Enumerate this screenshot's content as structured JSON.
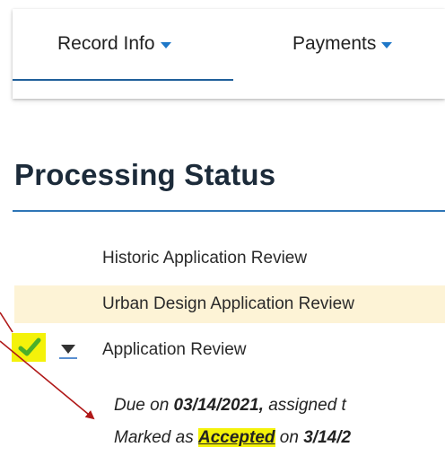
{
  "nav": {
    "tabs": [
      {
        "label": "Record Info",
        "active": true,
        "has_dropdown": true
      },
      {
        "label": "Payments",
        "active": false,
        "has_dropdown": true
      }
    ],
    "accent_color": "#1f78c8"
  },
  "section": {
    "title": "Processing Status",
    "rule_color": "#2e75b6"
  },
  "status_items": [
    {
      "label": "Historic Application Review",
      "highlighted": false
    },
    {
      "label": "Urban Design Application Review",
      "highlighted": true,
      "highlight_color": "#fdf3d6"
    },
    {
      "label": "Application Review",
      "checked": true,
      "expanded": true
    }
  ],
  "icons": {
    "check": "check-icon",
    "expand": "caret-down-icon"
  },
  "detail": {
    "line1": {
      "prefix": "Due on ",
      "date": "03/14/2021,",
      "suffix": " assigned t"
    },
    "line2": {
      "prefix": "Marked as ",
      "status": "Accepted",
      "middle": " on ",
      "date": "3/14/2"
    },
    "highlight_color": "#f4f20a"
  },
  "annotation": {
    "arrow_color": "#b01818"
  }
}
